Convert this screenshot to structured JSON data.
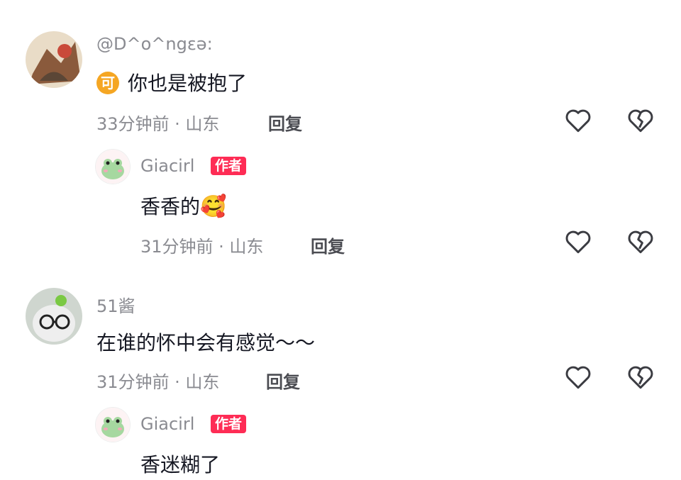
{
  "comments": [
    {
      "username": "@D^o^ngεə:",
      "text": "你也是被抱了",
      "badge_icon": "coin-icon",
      "badge_char": "可",
      "time": "33分钟前 · 山东",
      "reply_label": "回复",
      "reply": {
        "username": "Giacirl",
        "author_badge": "作者",
        "text": "香香的",
        "emoji": "🥰",
        "time": "31分钟前 · 山东",
        "reply_label": "回复"
      }
    },
    {
      "username": "51酱",
      "text": "在谁的怀中会有感觉～～",
      "time": "31分钟前 · 山东",
      "reply_label": "回复",
      "reply": {
        "username": "Giacirl",
        "author_badge": "作者",
        "text": "香迷糊了"
      }
    }
  ],
  "colors": {
    "author_badge": "#fe2c55",
    "meta_text": "#8a8b91",
    "body_text": "#161823"
  }
}
